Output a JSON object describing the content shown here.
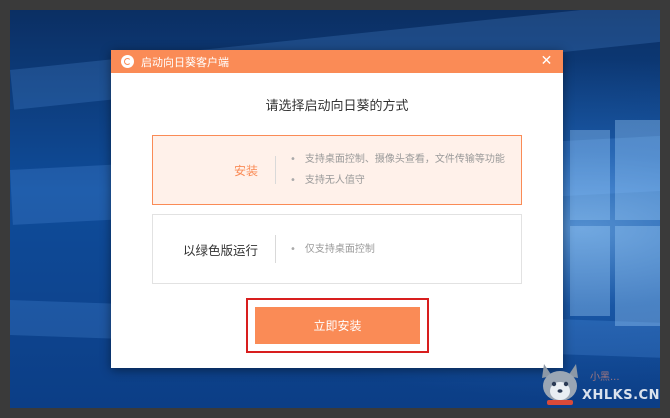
{
  "dialog": {
    "title": "启动向日葵客户端",
    "close_glyph": "✕",
    "heading": "请选择启动向日葵的方式",
    "options": [
      {
        "label": "安装",
        "features": [
          "支持桌面控制、摄像头查看，文件传输等功能",
          "支持无人值守"
        ],
        "selected": true
      },
      {
        "label": "以绿色版运行",
        "features": [
          "仅支持桌面控制"
        ],
        "selected": false
      }
    ],
    "install_button": "立即安装"
  },
  "watermark": {
    "text": "XHLKS.CN",
    "subtext": "小黑..."
  },
  "colors": {
    "accent": "#fa8b56",
    "highlight_border": "#d81e1e",
    "selected_bg": "#fff1ea"
  },
  "icons": {
    "app": "sunflower-logo-icon",
    "close": "close-icon",
    "watermark": "husky-mascot-icon"
  }
}
